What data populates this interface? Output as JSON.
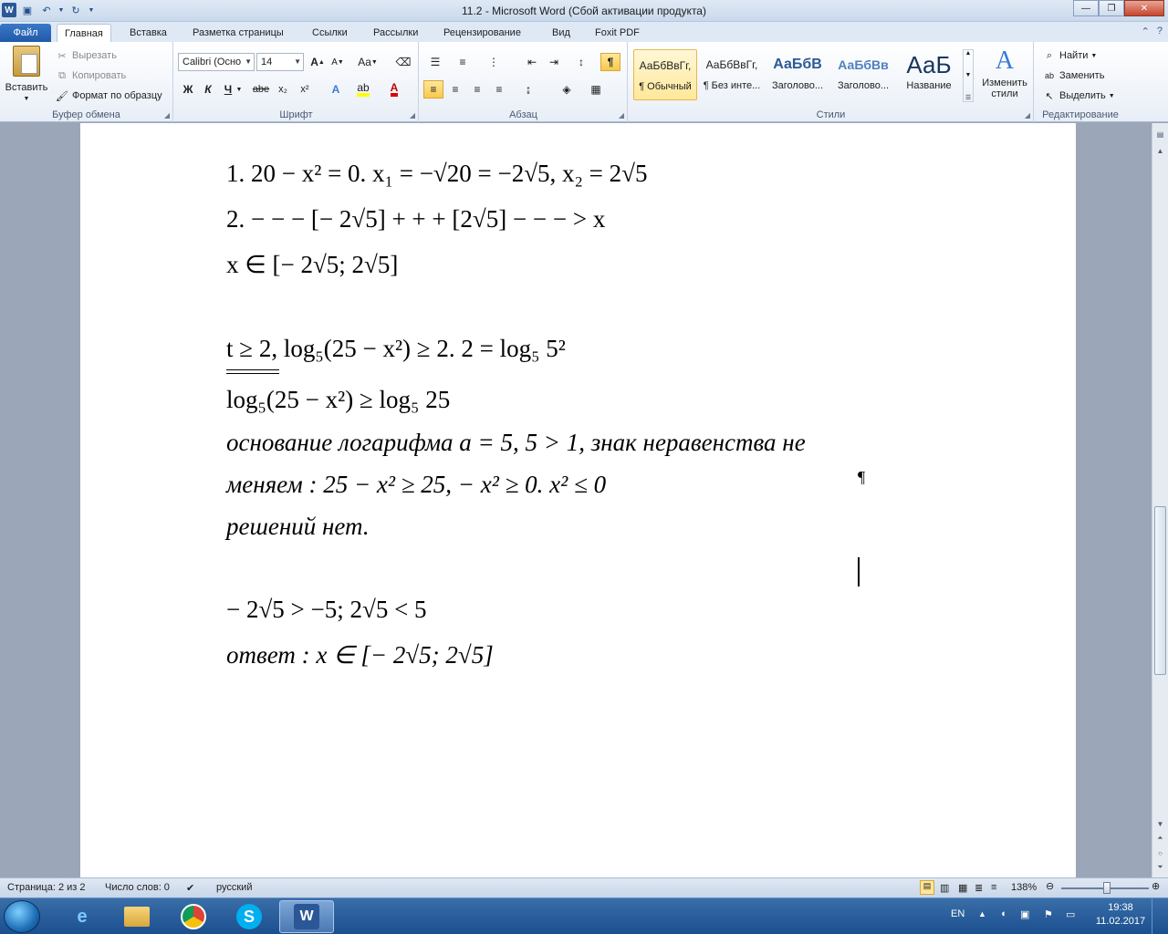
{
  "window": {
    "title": "11.2  -  Microsoft Word (Сбой активации продукта)"
  },
  "ribbon_tabs": {
    "file": "Файл",
    "home": "Главная",
    "insert": "Вставка",
    "layout": "Разметка страницы",
    "references": "Ссылки",
    "mailings": "Рассылки",
    "review": "Рецензирование",
    "view": "Вид",
    "foxit": "Foxit PDF"
  },
  "clipboard": {
    "paste": "Вставить",
    "cut": "Вырезать",
    "copy": "Копировать",
    "format_painter": "Формат по образцу",
    "group_label": "Буфер обмена"
  },
  "font": {
    "font_name": "Calibri (Осно",
    "font_size": "14",
    "bold": "Ж",
    "italic": "К",
    "underline": "Ч",
    "strike": "abe",
    "subscript": "x₂",
    "superscript": "x²",
    "grow": "A",
    "shrink": "A",
    "change_case": "Aa",
    "group_label": "Шрифт"
  },
  "paragraph": {
    "show_marks": "¶",
    "group_label": "Абзац"
  },
  "styles": {
    "items": [
      {
        "sample": "АаБбВвГг,",
        "name": "¶ Обычный"
      },
      {
        "sample": "АаБбВвГг,",
        "name": "¶ Без инте..."
      },
      {
        "sample": "АаБбВ",
        "name": "Заголово..."
      },
      {
        "sample": "АаБбВв",
        "name": "Заголово..."
      },
      {
        "sample": "АаБ",
        "name": "Название"
      }
    ],
    "change_styles": "Изменить стили",
    "group_label": "Стили"
  },
  "editing": {
    "find": "Найти",
    "replace": "Заменить",
    "select": "Выделить",
    "group_label": "Редактирование"
  },
  "document": {
    "lines": [
      "1.    20 − x² = 0.    x₁ = −√20 = −2√5,    x₂ = 2√5",
      "2.    − − − [− 2√5] + + + [2√5] − − − > x",
      "x ∈ [− 2√5; 2√5]",
      "t ≥ 2,    log₅(25 − x²) ≥ 2.    2 = log₅ 5²",
      "log₅(25 − x²) ≥ log₅ 25",
      "основание логарифма a = 5, 5 > 1, знак неравенства не",
      "меняем :    25 − x² ≥ 25,    − x² ≥ 0.    x² ≤ 0",
      "решений нет.",
      "− 2√5 > −5;    2√5 < 5",
      "ответ :    x ∈ [− 2√5; 2√5]"
    ],
    "pilcrow": "¶"
  },
  "statusbar": {
    "page": "Страница: 2 из 2",
    "words": "Число слов: 0",
    "language": "русский",
    "zoom": "138%"
  },
  "taskbar": {
    "lang": "EN",
    "time": "19:38",
    "date": "11.02.2017"
  }
}
